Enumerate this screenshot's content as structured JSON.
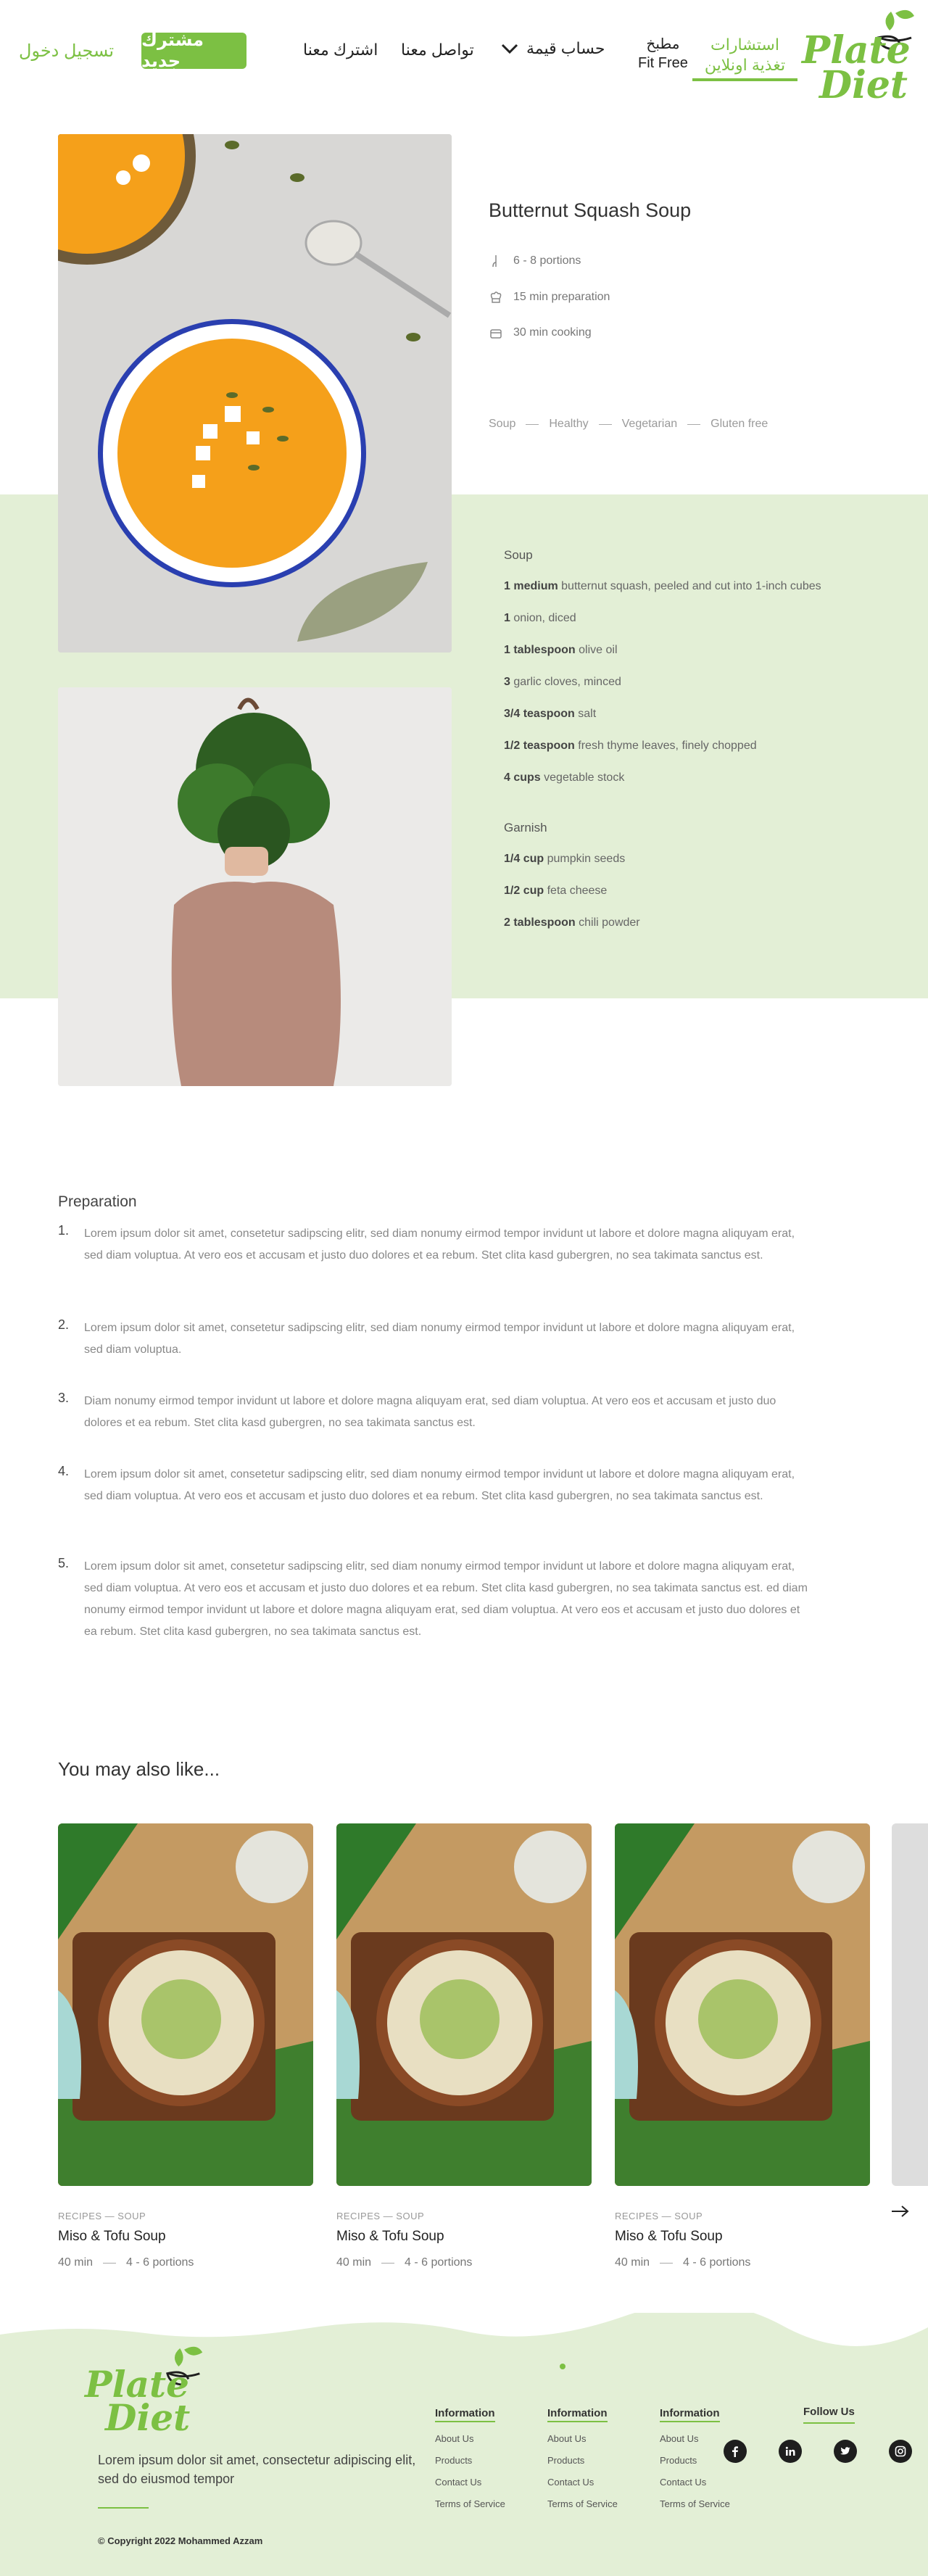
{
  "header": {
    "login": "تسجيل دخول",
    "signup": "مشترك جديد",
    "nav": {
      "subscribe": "اشترك معنا",
      "contact": "تواصل معنا",
      "calc": "حساب قيمة",
      "kitchen_line1": "مطبخ",
      "kitchen_line2": "Fit Free",
      "consult_line1": "استشارات",
      "consult_line2": "تغذية اونلاين"
    },
    "logo_line1": "Plate",
    "logo_line2": "Diet"
  },
  "recipe": {
    "title": "Butternut Squash Soup",
    "meta": {
      "portions": "6 - 8 portions",
      "prep": "15 min preparation",
      "cooking": "30 min cooking"
    },
    "tags": [
      "Soup",
      "Healthy",
      "Vegetarian",
      "Gluten free"
    ],
    "ingredients": {
      "soup_title": "Soup",
      "soup": [
        {
          "qty": "1 medium",
          "item": "butternut squash, peeled and cut into 1-inch cubes"
        },
        {
          "qty": "1",
          "item": "onion, diced"
        },
        {
          "qty": "1 tablespoon",
          "item": "olive oil"
        },
        {
          "qty": "3",
          "item": "garlic cloves, minced"
        },
        {
          "qty": "3/4 teaspoon",
          "item": "salt"
        },
        {
          "qty": "1/2 teaspoon",
          "item": "fresh thyme leaves, finely chopped"
        },
        {
          "qty": "4 cups",
          "item": "vegetable stock"
        }
      ],
      "garnish_title": "Garnish",
      "garnish": [
        {
          "qty": "1/4 cup",
          "item": "pumpkin seeds"
        },
        {
          "qty": "1/2 cup",
          "item": "feta cheese"
        },
        {
          "qty": "2 tablespoon",
          "item": "chili powder"
        }
      ]
    }
  },
  "preparation": {
    "title": "Preparation",
    "steps": [
      {
        "num": "1.",
        "text": "Lorem ipsum dolor sit amet, consetetur sadipscing elitr, sed diam nonumy eirmod tempor invidunt ut labore et dolore magna aliquyam erat, sed diam voluptua. At vero eos et accusam et justo duo dolores et ea rebum. Stet clita kasd gubergren, no sea takimata sanctus est."
      },
      {
        "num": "2.",
        "text": "Lorem ipsum dolor sit amet, consetetur sadipscing elitr, sed diam nonumy eirmod tempor invidunt ut labore et dolore magna aliquyam erat, sed diam voluptua."
      },
      {
        "num": "3.",
        "text": "Diam nonumy eirmod tempor invidunt ut labore et dolore magna aliquyam erat, sed diam voluptua. At vero eos et accusam et justo duo dolores et ea rebum. Stet clita kasd gubergren, no sea takimata sanctus est."
      },
      {
        "num": "4.",
        "text": "Lorem ipsum dolor sit amet, consetetur sadipscing elitr, sed diam nonumy eirmod tempor invidunt ut labore et dolore magna aliquyam erat, sed diam voluptua. At vero eos et accusam et justo duo dolores et ea rebum. Stet clita kasd gubergren, no sea takimata sanctus est."
      },
      {
        "num": "5.",
        "text": "Lorem ipsum dolor sit amet, consetetur sadipscing elitr, sed diam nonumy eirmod tempor invidunt ut labore et dolore magna aliquyam erat, sed diam voluptua. At vero eos et accusam et justo duo dolores et ea rebum. Stet clita kasd gubergren, no sea takimata sanctus est. ed diam nonumy eirmod tempor invidunt ut labore et dolore magna aliquyam erat, sed diam voluptua. At vero eos et accusam et justo duo dolores et ea rebum. Stet clita kasd gubergren, no sea takimata sanctus est."
      }
    ]
  },
  "also_like": {
    "title": "You may also like...",
    "cards": [
      {
        "category": "RECIPES — SOUP",
        "title": "Miso & Tofu Soup",
        "time": "40 min",
        "portions": "4 - 6 portions"
      },
      {
        "category": "RECIPES — SOUP",
        "title": "Miso & Tofu Soup",
        "time": "40 min",
        "portions": "4 - 6 portions"
      },
      {
        "category": "RECIPES — SOUP",
        "title": "Miso & Tofu Soup",
        "time": "40 min",
        "portions": "4 - 6 portions"
      }
    ]
  },
  "footer": {
    "logo_line1": "Plate",
    "logo_line2": "Diet",
    "description": "Lorem ipsum dolor sit amet, consectetur adipiscing elit, sed do eiusmod tempor",
    "copyright": "© Copyright 2022 Mohammed Azzam",
    "columns": [
      {
        "title": "Information",
        "links": [
          "About Us",
          "Products",
          "Contact Us",
          "Terms of Service"
        ]
      },
      {
        "title": "Information",
        "links": [
          "About Us",
          "Products",
          "Contact Us",
          "Terms of Service"
        ]
      },
      {
        "title": "Information",
        "links": [
          "About Us",
          "Products",
          "Contact Us",
          "Terms of Service"
        ]
      }
    ],
    "follow": "Follow Us",
    "socials": [
      "facebook-icon",
      "linkedin-icon",
      "twitter-icon",
      "instagram-icon"
    ]
  },
  "colors": {
    "accent": "#7cc043",
    "band": "#e3efd6"
  }
}
